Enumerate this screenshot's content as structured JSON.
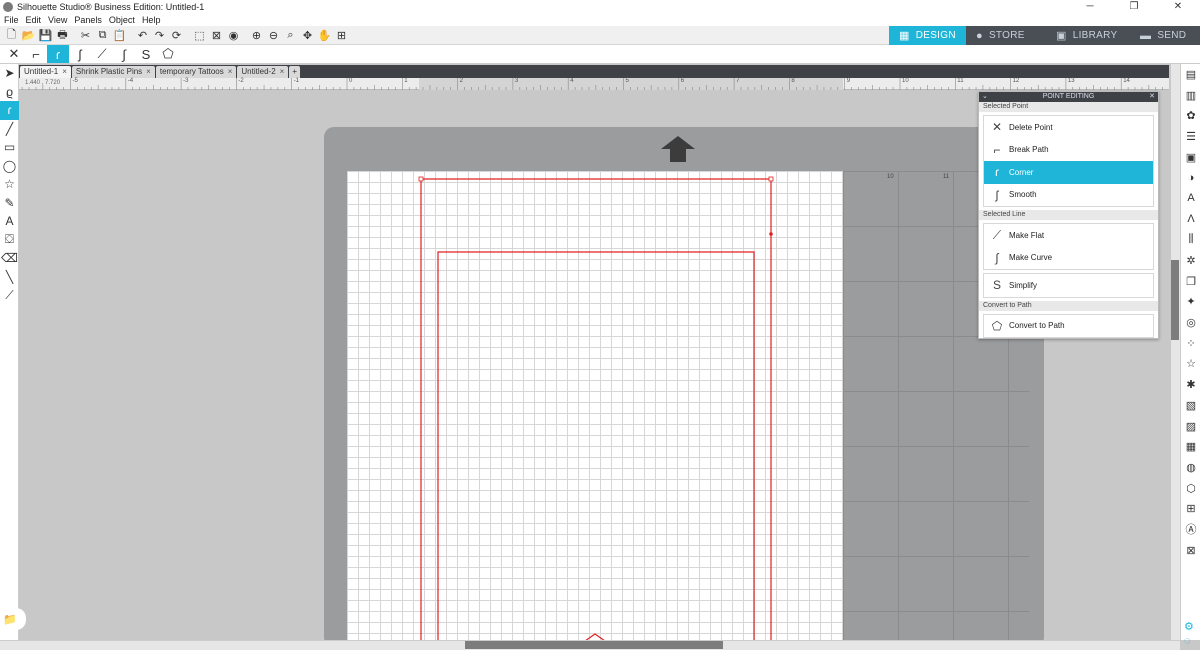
{
  "window": {
    "title": "Silhouette Studio® Business Edition: Untitled-1",
    "controls": [
      "─",
      "❐",
      "✕"
    ]
  },
  "menu": [
    "File",
    "Edit",
    "View",
    "Panels",
    "Object",
    "Help"
  ],
  "nav_tabs": [
    {
      "label": "DESIGN",
      "icon": "▦",
      "active": true
    },
    {
      "label": "STORE",
      "icon": "●",
      "active": false
    },
    {
      "label": "LIBRARY",
      "icon": "▣",
      "active": false
    },
    {
      "label": "SEND",
      "icon": "▬",
      "active": false
    }
  ],
  "doc_tabs": [
    {
      "label": "Untitled-1",
      "active": true
    },
    {
      "label": "Shrink Plastic Pins",
      "active": false
    },
    {
      "label": "temporary Tattoos",
      "active": false
    },
    {
      "label": "Untitled-2",
      "active": false
    }
  ],
  "doc_tab_close": "×",
  "doc_tab_add": "+",
  "coords": "1.440 , 7.720",
  "ruler_numbers": [
    "-5",
    "-4",
    "-3",
    "-2",
    "-1",
    "0",
    "1",
    "2",
    "3",
    "4",
    "5",
    "6",
    "7",
    "8",
    "9",
    "10",
    "11",
    "12",
    "13",
    "14"
  ],
  "mat_numbers": [
    "10",
    "11"
  ],
  "panel": {
    "title": "POINT EDITING",
    "sections": [
      {
        "heading": "Selected Point",
        "items": [
          {
            "label": "Delete Point",
            "icon": "✕"
          },
          {
            "label": "Break Path",
            "icon": "⌐"
          },
          {
            "label": "Corner",
            "icon": "ɾ",
            "selected": true
          },
          {
            "label": "Smooth",
            "icon": "ʃ"
          }
        ]
      },
      {
        "heading": "Selected Line",
        "items": [
          {
            "label": "Make Flat",
            "icon": "⟋"
          },
          {
            "label": "Make Curve",
            "icon": "∫"
          }
        ]
      },
      {
        "heading": "",
        "items": [
          {
            "label": "Simplify",
            "icon": "S"
          }
        ]
      },
      {
        "heading": "Convert to Path",
        "items": [
          {
            "label": "Convert to Path",
            "icon": "⬠"
          }
        ]
      }
    ]
  },
  "colors": {
    "accent": "#1fb5d8",
    "cut_line": "#e02020",
    "dark_bar": "#3e4247"
  }
}
